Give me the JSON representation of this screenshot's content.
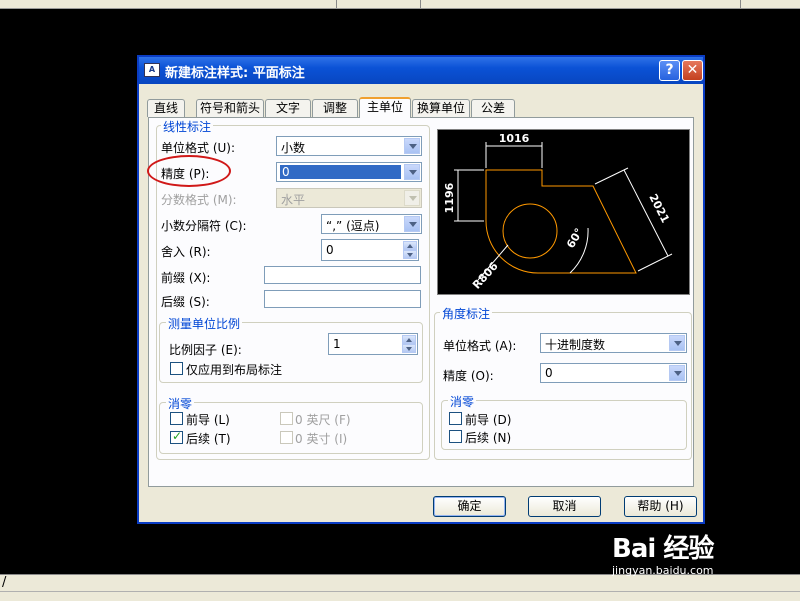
{
  "dialog": {
    "title": "新建标注样式: 平面标注",
    "title_icon": "A",
    "help_glyph": "?",
    "close_glyph": "✕"
  },
  "tabs": [
    "直线",
    "符号和箭头",
    "文字",
    "调整",
    "主单位",
    "换算单位",
    "公差"
  ],
  "active_tab": "主单位",
  "linear": {
    "legend": "线性标注",
    "unit_format_label": "单位格式 (U):",
    "unit_format_value": "小数",
    "precision_label": "精度 (P):",
    "precision_value": "0",
    "fraction_format_label": "分数格式 (M):",
    "fraction_format_value": "水平",
    "decimal_sep_label": "小数分隔符 (C):",
    "decimal_sep_value": "“,”  (逗点)",
    "round_off_label": "舍入 (R):",
    "round_off_value": "0",
    "prefix_label": "前缀 (X):",
    "suffix_label": "后缀 (S):"
  },
  "scale": {
    "legend": "测量单位比例",
    "factor_label": "比例因子 (E):",
    "factor_value": "1",
    "layout_only_label": "仅应用到布局标注"
  },
  "zero_linear": {
    "legend": "消零",
    "leading_label": "前导 (L)",
    "trailing_label": "后续 (T)",
    "feet_label": "0 英尺 (F)",
    "inches_label": "0 英寸 (I)",
    "leading_checked": false,
    "trailing_checked": true
  },
  "angular": {
    "legend": "角度标注",
    "unit_format_label": "单位格式 (A):",
    "unit_format_value": "十进制度数",
    "precision_label": "精度 (O):",
    "precision_value": "0"
  },
  "zero_angular": {
    "legend": "消零",
    "leading_label": "前导 (D)",
    "trailing_label": "后续 (N)"
  },
  "preview": {
    "dim_top": "1016",
    "dim_left": "1196",
    "dim_right": "2021",
    "dim_angle": "60°",
    "dim_radius": "R806",
    "line_color": "#ff9900",
    "dim_color": "#ffffff"
  },
  "buttons": {
    "ok": "确定",
    "cancel": "取消",
    "help": "帮助 (H)"
  },
  "watermark": {
    "logo": "Bai 经验",
    "url": "jingyan.baidu.com"
  },
  "command_line": "/",
  "annotation_color": "#d01818"
}
